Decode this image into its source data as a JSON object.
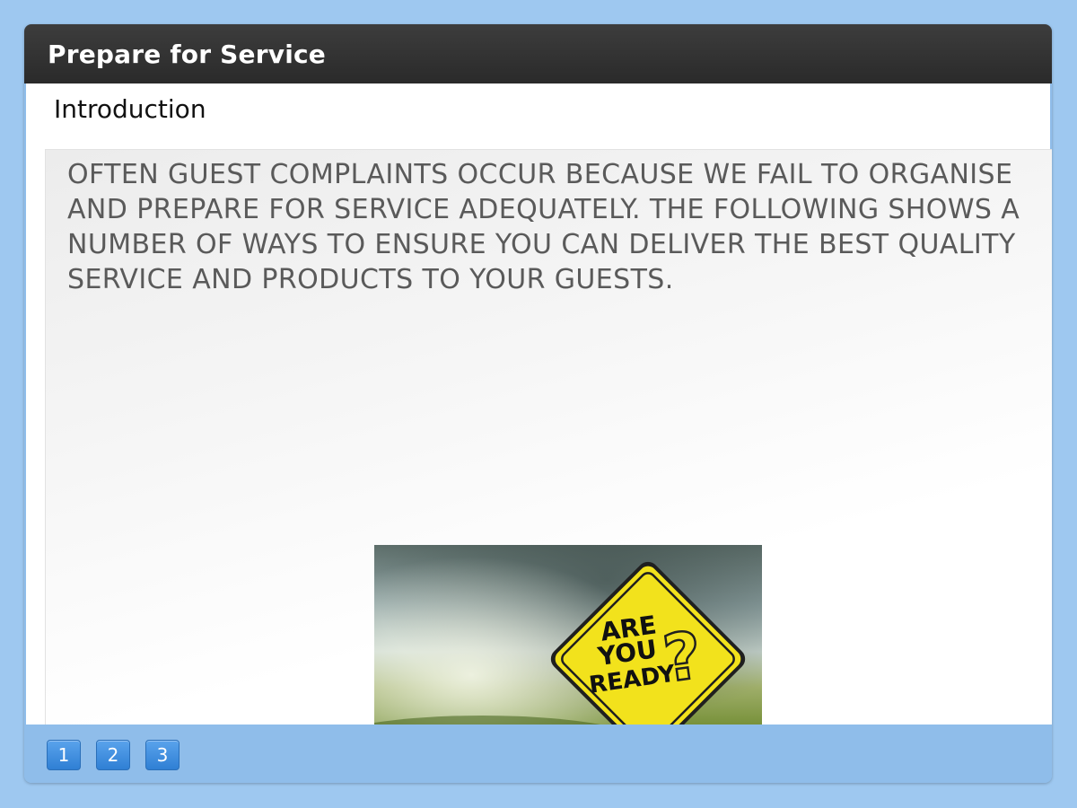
{
  "window": {
    "title": "Prepare for Service"
  },
  "content": {
    "section_heading": "Introduction",
    "intro_text": "OFTEN GUEST COMPLAINTS OCCUR BECAUSE WE FAIL TO ORGANISE AND PREPARE FOR SERVICE ADEQUATELY. THE FOLLOWING SHOWS A NUMBER OF WAYS TO ENSURE YOU CAN DELIVER THE BEST QUALITY SERVICE AND PRODUCTS TO YOUR GUESTS.",
    "image": {
      "sign_lines": [
        "ARE",
        "YOU",
        "READY"
      ],
      "sign_symbol": "?"
    }
  },
  "footer": {
    "pages": [
      "1",
      "2",
      "3"
    ]
  },
  "colors": {
    "background": "#9ec8f0",
    "title_bar": "#2f2f2f",
    "page_button": "#3d8ee0",
    "sign_yellow": "#f2e21c"
  }
}
